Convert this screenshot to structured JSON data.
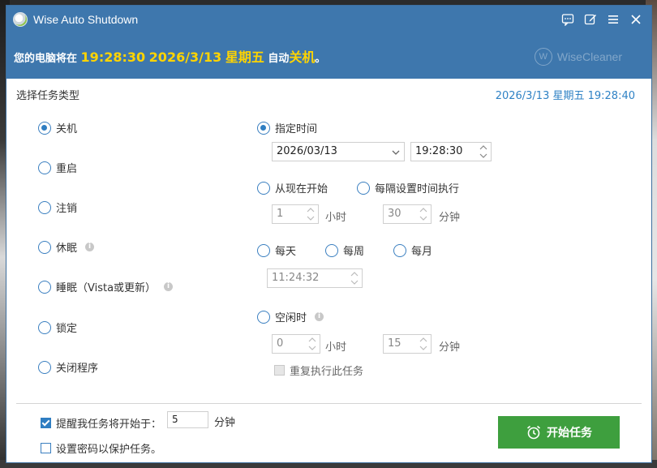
{
  "window": {
    "title": "Wise Auto Shutdown",
    "brand": "WiseCleaner",
    "header_color": "#3e77ad",
    "accent_color": "#2f7ec2",
    "start_button_color": "#3e9f3e"
  },
  "banner": {
    "prefix": "您的电脑将在",
    "time": "19:28:30",
    "date": "2026/3/13",
    "weekday": "星期五",
    "middle": "自动",
    "action": "关机",
    "suffix": "。"
  },
  "task_type": {
    "title": "选择任务类型",
    "options": [
      {
        "label": "关机",
        "selected": true
      },
      {
        "label": "重启",
        "selected": false
      },
      {
        "label": "注销",
        "selected": false
      },
      {
        "label": "休眠",
        "selected": false,
        "info": true
      },
      {
        "label": "睡眠（Vista或更新）",
        "selected": false,
        "info": true
      },
      {
        "label": "锁定",
        "selected": false
      },
      {
        "label": "关闭程序",
        "selected": false
      }
    ]
  },
  "current_datetime": "2026/3/13 星期五 19:28:40",
  "schedule": {
    "specific_time": {
      "label": "指定时间",
      "selected": true,
      "date": "2026/03/13",
      "time": "19:28:30"
    },
    "from_now": {
      "label": "从现在开始",
      "selected": false
    },
    "interval": {
      "label": "每隔设置时间执行",
      "selected": false
    },
    "from_now_hours": "1",
    "hours_unit": "小时",
    "from_now_minutes": "30",
    "minutes_unit": "分钟",
    "daily": {
      "label": "每天",
      "selected": false
    },
    "weekly": {
      "label": "每周",
      "selected": false
    },
    "monthly": {
      "label": "每月",
      "selected": false
    },
    "recurring_time": "11:24:32",
    "idle": {
      "label": "空闲时",
      "selected": false,
      "info": true
    },
    "idle_hours": "0",
    "idle_minutes": "15",
    "repeat_task": {
      "label": "重复执行此任务",
      "checked": false
    }
  },
  "footer": {
    "remind": {
      "label": "提醒我任务将开始于：",
      "checked": true,
      "value": "5",
      "unit": "分钟"
    },
    "password": {
      "label": "设置密码以保护任务。",
      "checked": false
    },
    "start_button": "开始任务"
  }
}
